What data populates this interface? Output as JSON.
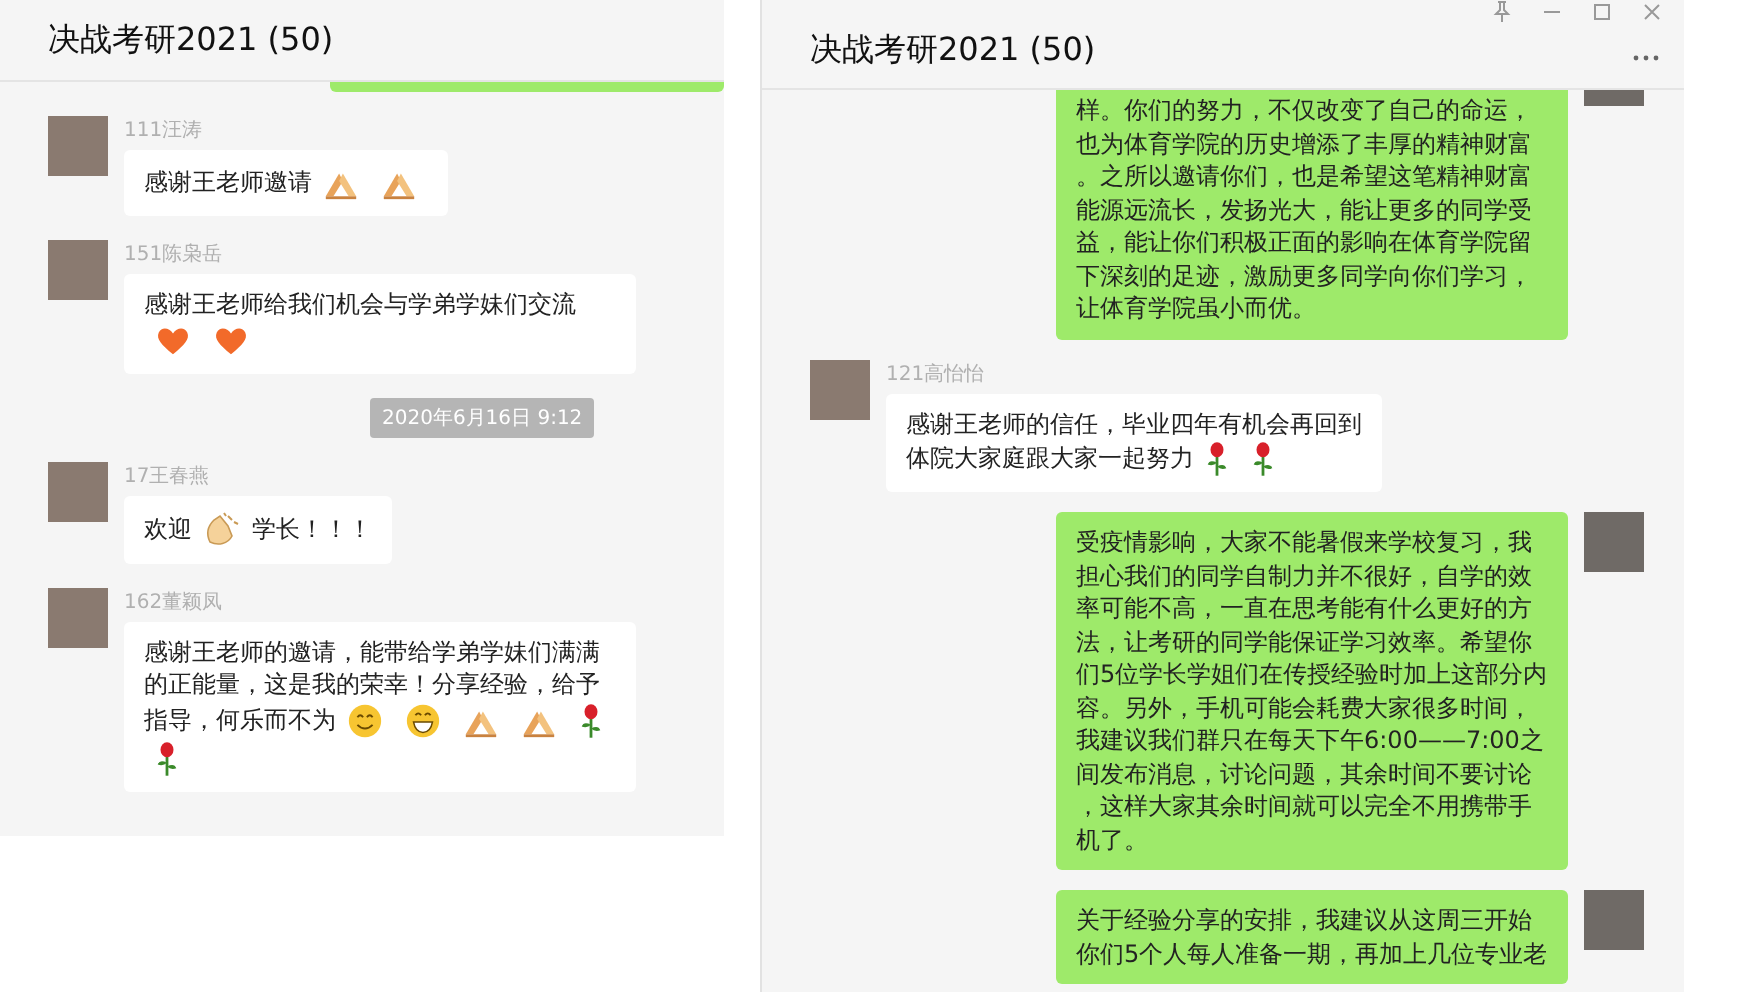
{
  "panels": [
    {
      "title": "决战考研2021 (50)",
      "window_controls": false,
      "messages": [
        {
          "kind": "outgoing_edge"
        },
        {
          "kind": "in",
          "sender": "111汪涛",
          "parts": [
            {
              "kind": "text",
              "text": "感谢王老师邀请"
            },
            {
              "kind": "pray"
            },
            {
              "kind": "pray"
            }
          ]
        },
        {
          "kind": "in",
          "sender": "151陈枭岳",
          "parts": [
            {
              "kind": "text",
              "text": "感谢王老师给我们机会与学弟学妹们交流"
            },
            {
              "kind": "heart"
            },
            {
              "kind": "heart"
            }
          ]
        },
        {
          "kind": "time",
          "text": "2020年6月16日 9:12"
        },
        {
          "kind": "in",
          "sender": "17王春燕",
          "parts": [
            {
              "kind": "text",
              "text": "欢迎"
            },
            {
              "kind": "clap"
            },
            {
              "kind": "text",
              "text": "学长！！！"
            }
          ]
        },
        {
          "kind": "in",
          "sender": "162董颖凤",
          "parts": [
            {
              "kind": "line",
              "text": "感谢王老师的邀请，能带给学弟学妹们满满的正能量，这是我的荣幸！分享经验，给予"
            },
            {
              "kind": "text",
              "text": "指导，何乐而不为"
            },
            {
              "kind": "smile"
            },
            {
              "kind": "grin"
            },
            {
              "kind": "pray"
            },
            {
              "kind": "pray"
            },
            {
              "kind": "rose"
            },
            {
              "kind": "rose"
            }
          ]
        }
      ]
    },
    {
      "title": "决战考研2021 (50)",
      "window_controls": true,
      "messages": [
        {
          "kind": "out",
          "cut_top": true,
          "parts": [
            {
              "kind": "text",
              "text": "样。你们的努力，不仅改变了自己的命运，也为体育学院的历史增添了丰厚的精神财富。之所以邀请你们，也是希望这笔精神财富能源远流长，发扬光大，能让更多的同学受益，能让你们积极正面的影响在体育学院留下深刻的足迹，激励更多同学向你们学习，让体育学院虽小而优。"
            }
          ]
        },
        {
          "kind": "in",
          "sender": "121高怡怡",
          "parts": [
            {
              "kind": "line",
              "text": "感谢王老师的信任，毕业四年有机会再回到"
            },
            {
              "kind": "text",
              "text": "体院大家庭跟大家一起努力"
            },
            {
              "kind": "rose"
            },
            {
              "kind": "rose"
            }
          ]
        },
        {
          "kind": "out",
          "parts": [
            {
              "kind": "text",
              "text": "受疫情影响，大家不能暑假来学校复习，我担心我们的同学自制力并不很好，自学的效率可能不高，一直在思考能有什么更好的方法，让考研的同学能保证学习效率。希望你们5位学长学姐们在传授经验时加上这部分内容。另外，手机可能会耗费大家很多时间，我建议我们群只在每天下午6:00——7:00之间发布消息，讨论问题，其余时间不要讨论，这样大家其余时间就可以完全不用携带手机了。"
            }
          ]
        },
        {
          "kind": "out",
          "parts": [
            {
              "kind": "text",
              "text": "关于经验分享的安排，我建议从这周三开始你们5个人每人准备一期，再加上几位专业老"
            }
          ]
        }
      ]
    }
  ]
}
